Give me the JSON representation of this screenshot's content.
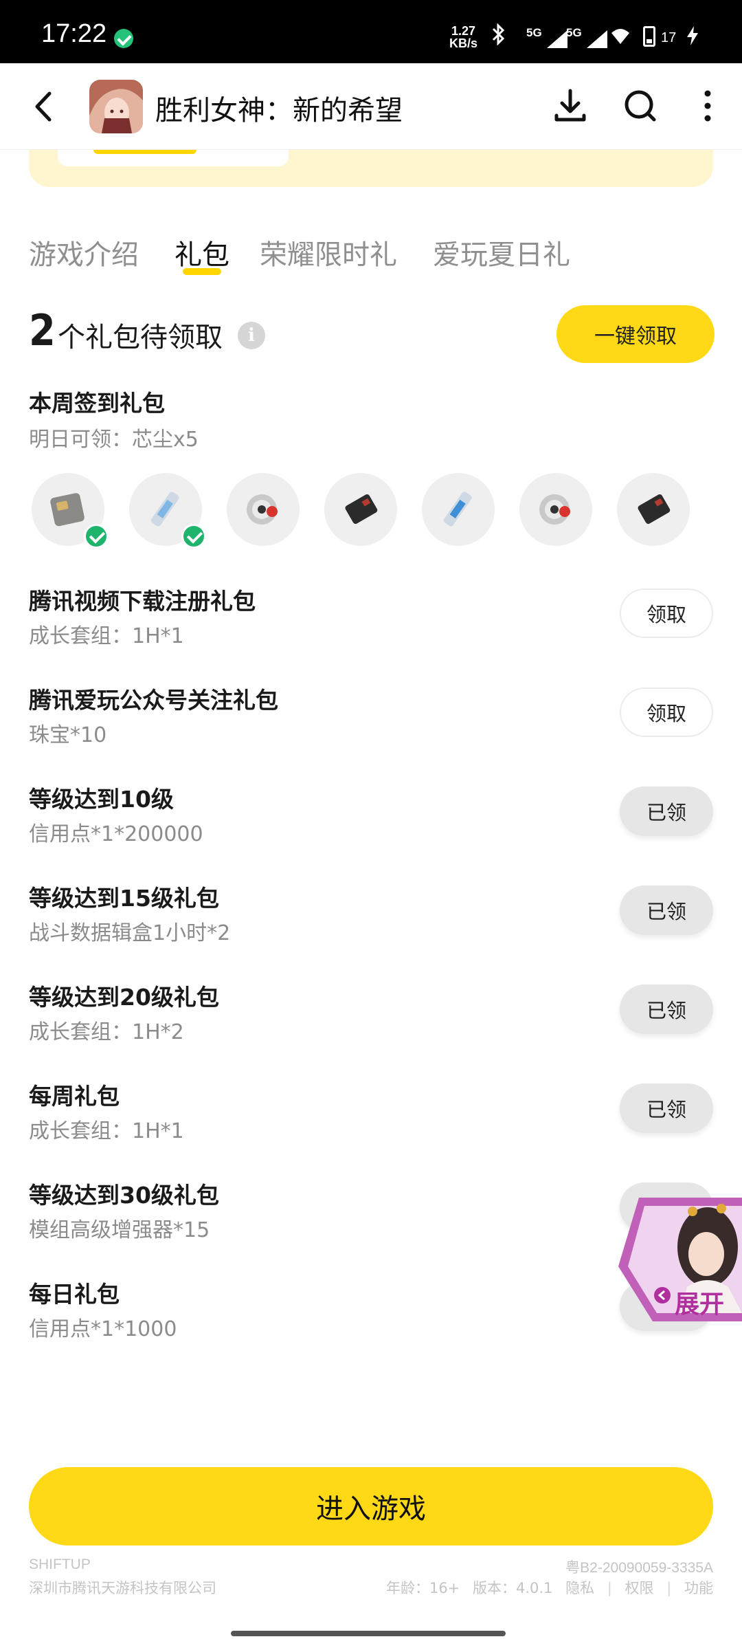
{
  "status_bar": {
    "time": "17:22",
    "net_speed_value": "1.27",
    "net_speed_unit": "KB/s",
    "signal1_label": "5G",
    "signal2_label": "5G",
    "battery": "17"
  },
  "header": {
    "title": "胜利女神：新的希望"
  },
  "tabs": [
    "游戏介绍",
    "礼包",
    "荣耀限时礼",
    "爱玩夏日礼"
  ],
  "active_tab": "礼包",
  "summary": {
    "count": "2",
    "text": "个礼包待领取",
    "info_icon": "i",
    "claim_all_label": "一键领取"
  },
  "weekly": {
    "title": "本周签到礼包",
    "subtitle": "明日可领：芯尘x5",
    "days": [
      {
        "icon": "card-chip-icon",
        "claimed": true
      },
      {
        "icon": "usb-drive-icon",
        "claimed": true
      },
      {
        "icon": "robot-eye-icon",
        "claimed": false
      },
      {
        "icon": "black-chip-icon",
        "claimed": false
      },
      {
        "icon": "usb-drive-icon",
        "claimed": false
      },
      {
        "icon": "robot-eye-icon",
        "claimed": false
      },
      {
        "icon": "black-chip-icon",
        "claimed": false
      }
    ]
  },
  "gifts": [
    {
      "name": "腾讯视频下载注册礼包",
      "desc": "成长套组：1H*1",
      "button": "领取",
      "state": "claim"
    },
    {
      "name": "腾讯爱玩公众号关注礼包",
      "desc": "珠宝*10",
      "button": "领取",
      "state": "claim"
    },
    {
      "name": "等级达到10级",
      "desc": "信用点*1*200000",
      "button": "已领",
      "state": "claimed"
    },
    {
      "name": "等级达到15级礼包",
      "desc": "战斗数据辑盒1小时*2",
      "button": "已领",
      "state": "claimed"
    },
    {
      "name": "等级达到20级礼包",
      "desc": "成长套组：1H*2",
      "button": "已领",
      "state": "claimed"
    },
    {
      "name": "每周礼包",
      "desc": "成长套组：1H*1",
      "button": "已领",
      "state": "claimed"
    },
    {
      "name": "等级达到30级礼包",
      "desc": "模组高级增强器*15",
      "button": "",
      "state": "claimed"
    },
    {
      "name": "每日礼包",
      "desc": "信用点*1*1000",
      "button": "",
      "state": "claimed"
    }
  ],
  "float_widget": {
    "label": "展开"
  },
  "enter_button": "进入游戏",
  "footer": {
    "brand": "SHIFTUP",
    "company": "深圳市腾讯天游科技有限公司",
    "license": "粤B2-20090059-3335A",
    "age": "年龄：16+",
    "version": "版本：4.0.1",
    "privacy": "隐私",
    "permissions": "权限",
    "features": "功能"
  },
  "colors": {
    "accent": "#ffd916",
    "check": "#1fb46b",
    "muted_text": "#8b8b8b"
  }
}
